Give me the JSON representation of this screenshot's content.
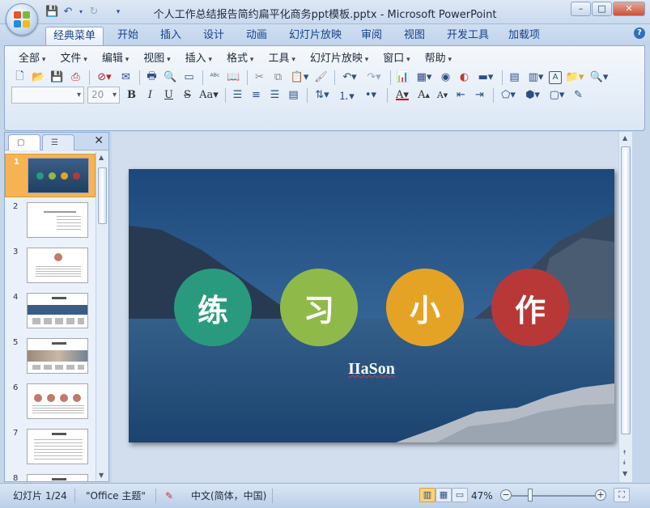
{
  "window": {
    "title": "个人工作总结报告简约扁平化商务ppt模板.pptx - Microsoft PowerPoint",
    "controls": [
      "–",
      "□",
      "✕"
    ]
  },
  "qat": {
    "icons": [
      "save-icon",
      "undo-icon",
      "redo-icon",
      "customize-icon"
    ]
  },
  "ribbon_tabs": [
    "经典菜单",
    "开始",
    "插入",
    "设计",
    "动画",
    "幻灯片放映",
    "审阅",
    "视图",
    "开发工具",
    "加载项"
  ],
  "menu": [
    "全部",
    "文件",
    "编辑",
    "视图",
    "插入",
    "格式",
    "工具",
    "幻灯片放映",
    "窗口",
    "帮助"
  ],
  "format": {
    "font_name": "",
    "font_size": "20",
    "bold": "B",
    "italic": "I",
    "underline": "U",
    "case": "Aa"
  },
  "slides_panel": {
    "numbers": [
      "1",
      "2",
      "3",
      "4",
      "5",
      "6",
      "7",
      "8"
    ],
    "selected": 1
  },
  "slide": {
    "circles": [
      {
        "char": "练",
        "color": "#2a9a7e"
      },
      {
        "char": "习",
        "color": "#8fba4a"
      },
      {
        "char": "小",
        "color": "#e5a326"
      },
      {
        "char": "作",
        "color": "#b83838"
      }
    ],
    "author": "IIaSon"
  },
  "status": {
    "slide_info": "幻灯片 1/24",
    "theme": "\"Office 主题\"",
    "language": "中文(简体，中国)",
    "zoom": "47%",
    "zoom_level": 0.47
  }
}
